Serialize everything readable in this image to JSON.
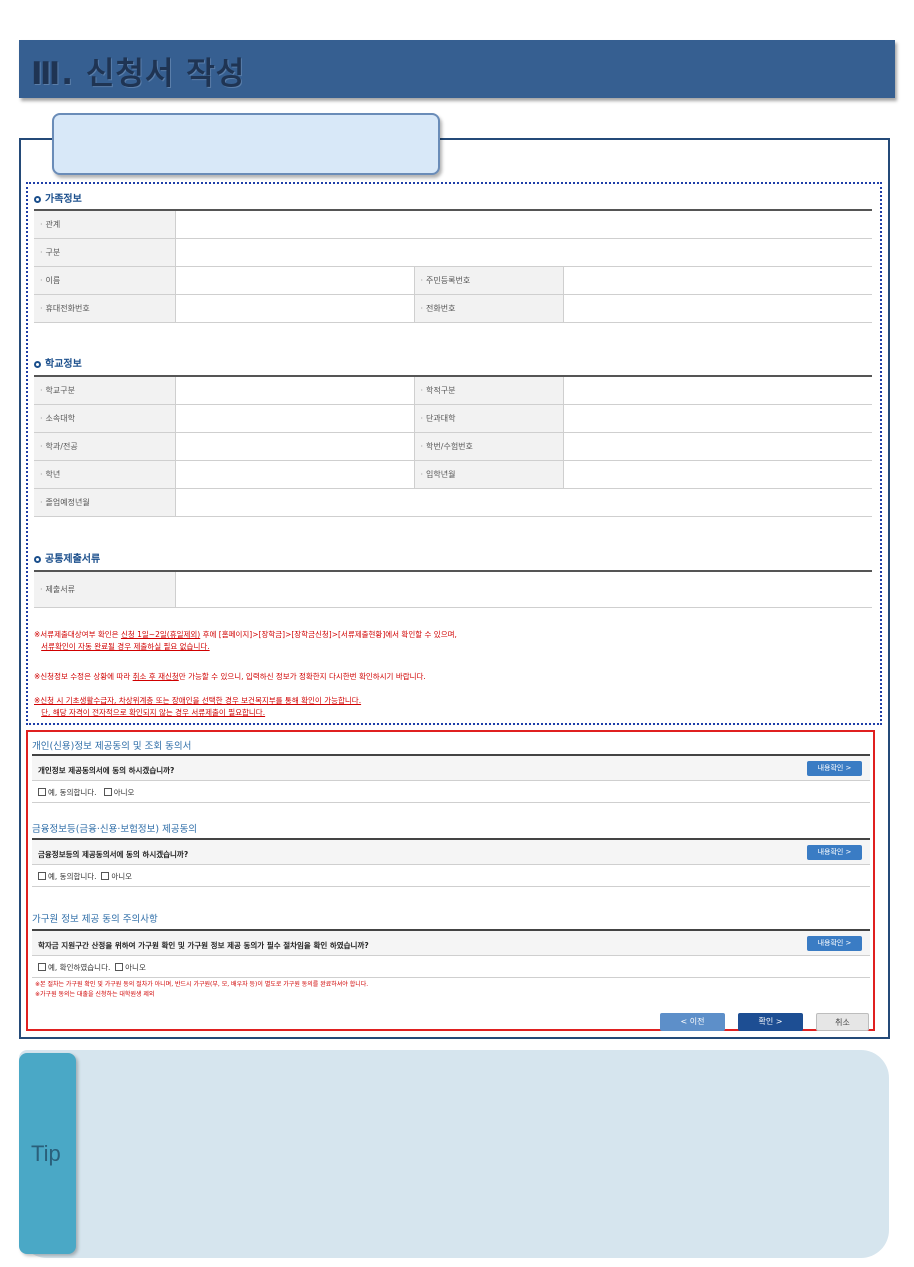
{
  "banner": {
    "title": "Ⅲ. 신청서 작성"
  },
  "family": {
    "title": "가족정보",
    "rows": [
      {
        "l1": "관계",
        "l2": ""
      },
      {
        "l1": "구분",
        "l2": ""
      },
      {
        "l1": "이름",
        "l2": "주민등록번호"
      },
      {
        "l1": "휴대전화번호",
        "l2": "전화번호"
      }
    ]
  },
  "school": {
    "title": "학교정보",
    "rows": [
      {
        "l1": "학교구분",
        "l2": "학적구분"
      },
      {
        "l1": "소속대학",
        "l2": "단과대학"
      },
      {
        "l1": "학과/전공",
        "l2": "학번/수험번호"
      },
      {
        "l1": "학년",
        "l2": "입학년월"
      },
      {
        "l1": "졸업예정년월",
        "l2": ""
      }
    ]
  },
  "docs": {
    "title": "공통제출서류",
    "label": "제출서류"
  },
  "notes": {
    "n1a": "※서류제출대상여부 확인은 ",
    "n1b": "신청 1일~2일(휴일제외)",
    "n1c": " 후에 [홈페이지]>[장학금]>[장학금신청]>[서류제출현황]에서 확인할 수 있으며,",
    "n1d": "서류확인이 자동 완료될 경우 제출하실 필요 없습니다.",
    "n2a": "※신청정보 수정은 상황에 따라 ",
    "n2b": "취소 후 재신청",
    "n2c": "만 가능할 수 있으니, 입력하신 정보가 정확한지 다시한번 확인하시기 바랍니다.",
    "n3a": "※신청 시 기초생활수급자, 차상위계층 또는 장애인을 선택한 경우 보건복지부를 통해 확인이 가능합니다.",
    "n3b": "단, 해당 자격이 전자적으로 확인되지 않는 경우 서류제출이 필요합니다."
  },
  "agree1": {
    "title": "개인(신용)정보 제공동의 및 조회 동의서",
    "question": "개인정보 제공동의서에 동의 하시겠습니까?",
    "detail": "내용확인 >",
    "yes": "예, 동의합니다.",
    "no": "아니오"
  },
  "agree2": {
    "title": "금융정보등(금융·신용·보험정보) 제공동의",
    "question": "금융정보등의 제공동의서에 동의 하시겠습니까?",
    "detail": "내용확인 >",
    "yes": "예, 동의합니다.",
    "no": "아니오"
  },
  "agree3": {
    "title": "가구원 정보 제공 동의 주의사항",
    "question": "학자금 지원구간 산정을 위하여 가구원 확인 및 가구원 정보 제공 동의가 필수 절차임을 확인 하였습니까?",
    "detail": "내용확인 >",
    "yes": "예, 확인하였습니다.",
    "no": "아니오"
  },
  "agree_notes": {
    "n1": "※본 절차는 가구원 확인 및 가구원 동의 절차가 아니며, 반드시 가구원(부, 모, 배우자 등)이 별도로 가구원 동의를 완료하셔야 합니다.",
    "n2": "※가구원 동의는 대출을 신청하는 대학원생 제외"
  },
  "buttons": {
    "prev": "<  이전",
    "ok": "확인  >",
    "cancel": "취소"
  },
  "tip": {
    "label": "Tip"
  }
}
